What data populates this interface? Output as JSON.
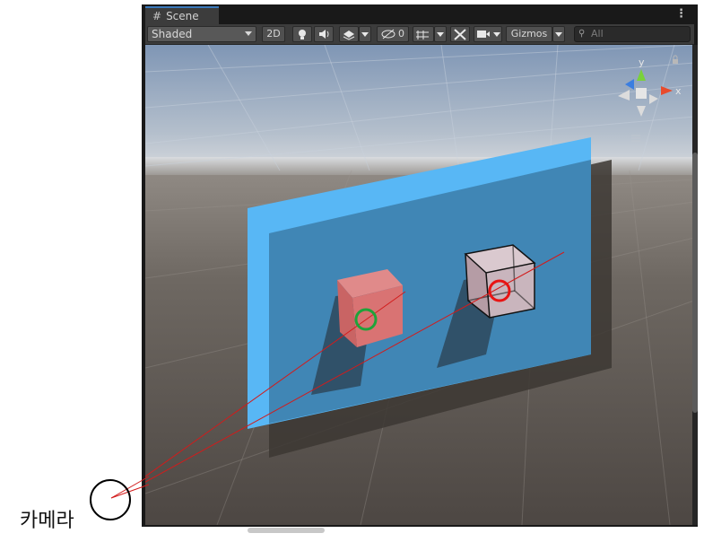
{
  "tab": {
    "label": "Scene"
  },
  "toolbar": {
    "shading_mode": "Shaded",
    "two_d_label": "2D",
    "hidden_count": "0",
    "gizmos_label": "Gizmos",
    "search_placeholder": "All"
  },
  "axis_gizmo": {
    "x": "x",
    "y": "y"
  },
  "annotation": {
    "camera_label": "카메라"
  },
  "colors": {
    "plane": "#58b7f5",
    "red_cube": "#d97373",
    "selected_cube": "#c9b5bd",
    "green_marker": "#1fa33a",
    "red_marker": "#e81414",
    "ray": "#d21b1b"
  }
}
